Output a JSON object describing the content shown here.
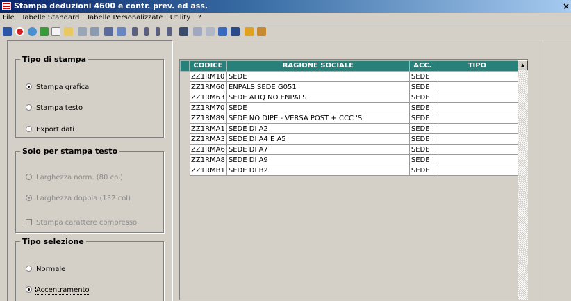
{
  "window": {
    "title": "Stampa deduzioni 4600 e contr. prev. ed ass.",
    "close_glyph": "×"
  },
  "menu": [
    "File",
    "Tabelle Standard",
    "Tabelle Personalizzate",
    "Utility",
    "?"
  ],
  "toolbar": {
    "buttons": [
      "save-icon",
      "cancel-icon",
      "refresh-icon",
      "export-icon",
      "new-icon",
      "open-folder-icon",
      "print-icon",
      "print-preview-icon",
      "find-icon",
      "folder-icon",
      "first-record-icon",
      "prev-record-icon",
      "next-record-icon",
      "last-record-icon",
      "grid-icon",
      "calculator-icon",
      "sheet-icon",
      "document-icon",
      "chart-icon",
      "home-icon",
      "exit-icon"
    ]
  },
  "tipo_stampa": {
    "legend": "Tipo di stampa",
    "options": [
      {
        "label": "Stampa grafica",
        "checked": true
      },
      {
        "label": "Stampa testo",
        "checked": false
      },
      {
        "label": "Export dati",
        "checked": false
      }
    ]
  },
  "solo_testo": {
    "legend": "Solo per stampa testo",
    "options": [
      {
        "label": "Larghezza norm. (80 col)",
        "checked": false
      },
      {
        "label": "Larghezza doppia (132 col)",
        "checked": true
      }
    ],
    "checkbox_label": "Stampa carattere compresso"
  },
  "tipo_selezione": {
    "legend": "Tipo selezione",
    "options": [
      {
        "label": "Normale",
        "checked": false
      },
      {
        "label": "Accentramento",
        "checked": true
      }
    ]
  },
  "grid": {
    "columns": [
      "CODICE",
      "RAGIONE SOCIALE",
      "ACC.",
      "TIPO"
    ],
    "rows": [
      [
        "ZZ1RM10",
        "SEDE",
        "SEDE",
        ""
      ],
      [
        "ZZ1RM60",
        "ENPALS SEDE G051",
        "SEDE",
        ""
      ],
      [
        "ZZ1RM63",
        "SEDE ALIQ NO ENPALS",
        "SEDE",
        ""
      ],
      [
        "ZZ1RM70",
        "SEDE",
        "SEDE",
        ""
      ],
      [
        "ZZ1RM89",
        "SEDE NO DIPE - VERSA POST + CCC 'S'",
        "SEDE",
        ""
      ],
      [
        "ZZ1RMA1",
        "SEDE DI A2",
        "SEDE",
        ""
      ],
      [
        "ZZ1RMA3",
        "SEDE DI A4 E A5",
        "SEDE",
        ""
      ],
      [
        "ZZ1RMA6",
        "SEDE DI A7",
        "SEDE",
        ""
      ],
      [
        "ZZ1RMA8",
        "SEDE DI A9",
        "SEDE",
        ""
      ],
      [
        "ZZ1RMB1",
        "SEDE DI B2",
        "SEDE",
        ""
      ]
    ]
  },
  "colors": {
    "title_start": "#0a246a",
    "title_end": "#a6caf0",
    "grid_header": "#27807a",
    "face": "#d4d0c8"
  }
}
